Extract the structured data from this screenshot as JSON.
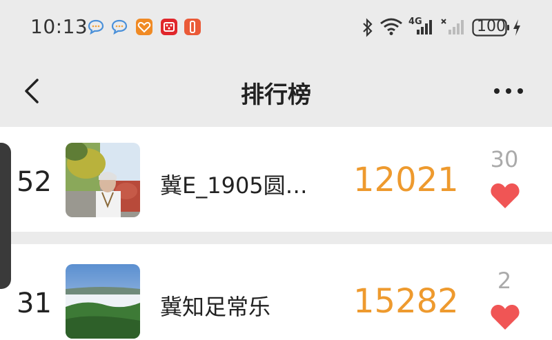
{
  "status_bar": {
    "time": "10:13",
    "network": "4G",
    "battery": "100",
    "icons": [
      "chat-bubble-icon",
      "chat-bubble-icon",
      "health-app-icon",
      "app-icon",
      "app-icon",
      "bluetooth-icon",
      "wifi-icon",
      "signal-icon",
      "signal-icon",
      "battery-icon",
      "charging-icon"
    ]
  },
  "nav": {
    "title": "排行榜",
    "back_icon": "chevron-left-icon",
    "more_icon": "more-icon"
  },
  "ranking": [
    {
      "rank": "52",
      "name": "冀E_1905圆…",
      "steps": "12021",
      "likes": "30"
    },
    {
      "rank": "31",
      "name": "冀知足常乐",
      "steps": "15282",
      "likes": "2"
    }
  ],
  "colors": {
    "steps": "#ee9a2e",
    "heart": "#f05555",
    "background": "#ebebeb"
  }
}
